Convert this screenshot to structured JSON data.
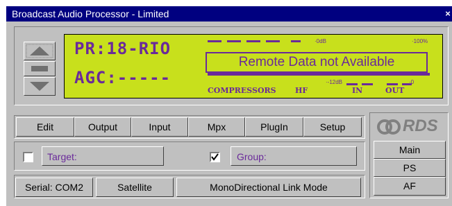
{
  "window": {
    "title": "Broadcast Audio Processor - Limited",
    "close_glyph": "×"
  },
  "display": {
    "preset_label": "PR:",
    "preset_value": "18-RIO",
    "agc_label": "AGC:",
    "agc_value": "-----",
    "message": "Remote Data not Available",
    "meters": {
      "zero_db": "·0dB",
      "hundred_pct": "·100%",
      "minus12": "·-12dB",
      "zero": "·0",
      "compressors": "COMPRESSORS",
      "hf": "HF",
      "in": "IN",
      "out": "OUT"
    }
  },
  "toolbar": [
    "Edit",
    "Output",
    "Input",
    "Mpx",
    "PlugIn",
    "Setup"
  ],
  "rds": {
    "logo": "RDS",
    "buttons": [
      "Main",
      "PS",
      "AF"
    ]
  },
  "target": {
    "label": "Target:",
    "checked": false
  },
  "group": {
    "label": "Group:",
    "checked": true
  },
  "status": {
    "serial": "Serial: COM2",
    "link": "Satellite",
    "mode": "MonoDirectional Link Mode"
  },
  "colors": {
    "lcd_background": "#c8e01c",
    "lcd_text": "#6a2a9a",
    "titlebar": "#000080",
    "face": "#c0c0c0"
  }
}
